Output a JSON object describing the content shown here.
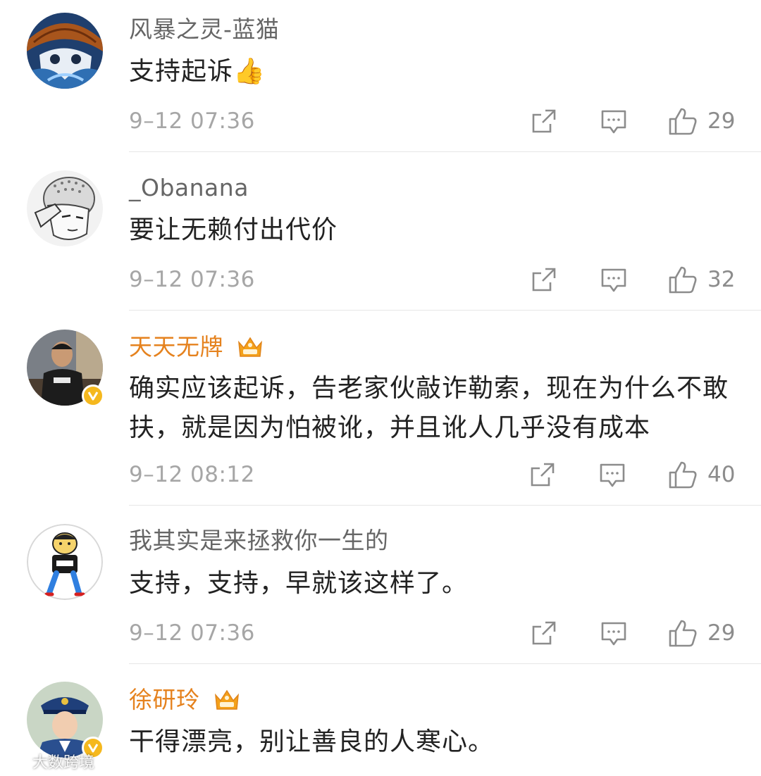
{
  "comments": [
    {
      "username": "风暴之灵-蓝猫",
      "text": "支持起诉👍",
      "time": "9–12 07:36",
      "likes": "29",
      "vip": false,
      "verified": false
    },
    {
      "username": "_Obanana",
      "text": "要让无赖付出代价",
      "time": "9–12 07:36",
      "likes": "32",
      "vip": false,
      "verified": false
    },
    {
      "username": "天天无牌",
      "text": "确实应该起诉，告老家伙敲诈勒索，现在为什么不敢扶，就是因为怕被讹，并且讹人几乎没有成本",
      "time": "9–12 08:12",
      "likes": "40",
      "vip": true,
      "verified": true
    },
    {
      "username": "我其实是来拯救你一生的",
      "text": "支持，支持，早就该这样了。",
      "time": "9–12 07:36",
      "likes": "29",
      "vip": false,
      "verified": false
    },
    {
      "username": "徐研玲",
      "text": "干得漂亮，别让善良的人寒心。",
      "time": "",
      "likes": "",
      "vip": true,
      "verified": true
    }
  ],
  "icons": {
    "repost": "repost-icon",
    "comment": "comment-icon",
    "like": "thumbs-up-icon",
    "crown": "vip-crown-icon",
    "verified": "verified-v-icon"
  },
  "colors": {
    "vip_name": "#e5821e",
    "normal_name": "#666666",
    "text": "#222222",
    "meta": "#a6a6a6",
    "badge": "#f5b81e"
  },
  "watermark": "大数跨境"
}
